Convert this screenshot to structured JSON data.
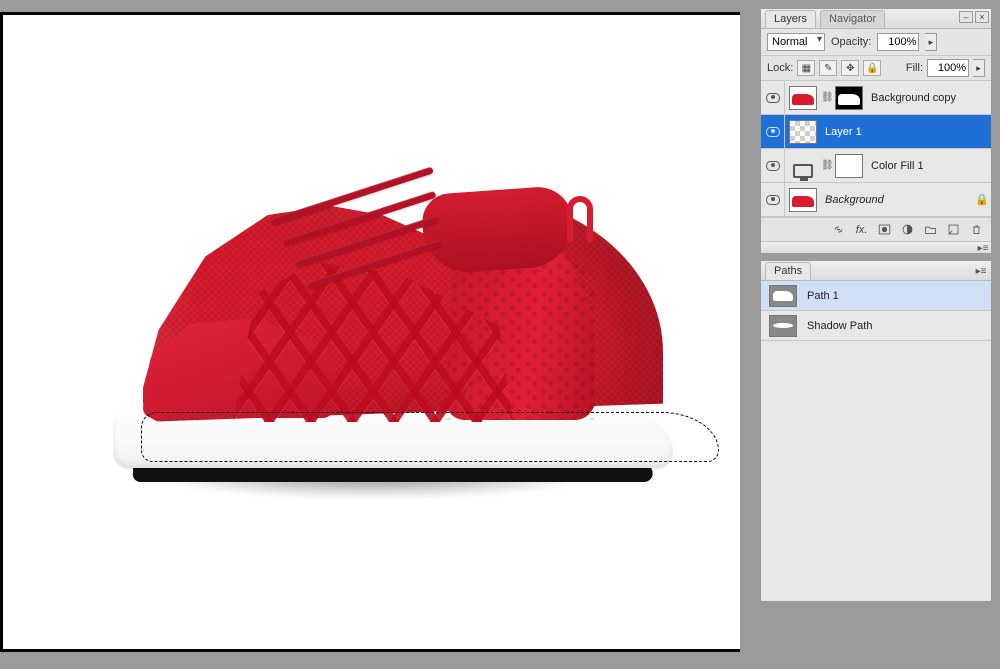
{
  "tabs": {
    "layers": "Layers",
    "navigator": "Navigator",
    "paths": "Paths"
  },
  "layersPanel": {
    "blendMode": "Normal",
    "opacityLabel": "Opacity:",
    "opacityValue": "100%",
    "lockLabel": "Lock:",
    "fillLabel": "Fill:",
    "fillValue": "100%",
    "lockIcons": {
      "transparent": "▦",
      "image": "✎",
      "position": "✥",
      "all": "🔒"
    }
  },
  "layers": [
    {
      "name": "Background copy",
      "selected": false,
      "visible": true,
      "thumb": "shoe",
      "mask": "mask-shoe",
      "linked": true,
      "italic": false,
      "locked": false
    },
    {
      "name": "Layer 1",
      "selected": true,
      "visible": true,
      "thumb": "checker",
      "mask": null,
      "linked": false,
      "italic": false,
      "locked": false
    },
    {
      "name": "Color Fill 1",
      "selected": false,
      "visible": true,
      "thumb": "adjustment",
      "mask": "solid-white",
      "linked": true,
      "italic": false,
      "locked": false
    },
    {
      "name": "Background",
      "selected": false,
      "visible": true,
      "thumb": "shoe",
      "mask": null,
      "linked": false,
      "italic": true,
      "locked": true
    }
  ],
  "layerFooter": {
    "link": "link-icon",
    "fx": "fx.",
    "mask": "mask-icon",
    "adjust": "adjust-icon",
    "group": "group-icon",
    "new": "new-icon",
    "trash": "trash-icon"
  },
  "paths": [
    {
      "name": "Path 1",
      "selected": true,
      "thumb": "shoe"
    },
    {
      "name": "Shadow Path",
      "selected": false,
      "thumb": "shadow"
    }
  ],
  "window": {
    "minimize": "–",
    "close": "×",
    "flyout": "▸≡"
  }
}
